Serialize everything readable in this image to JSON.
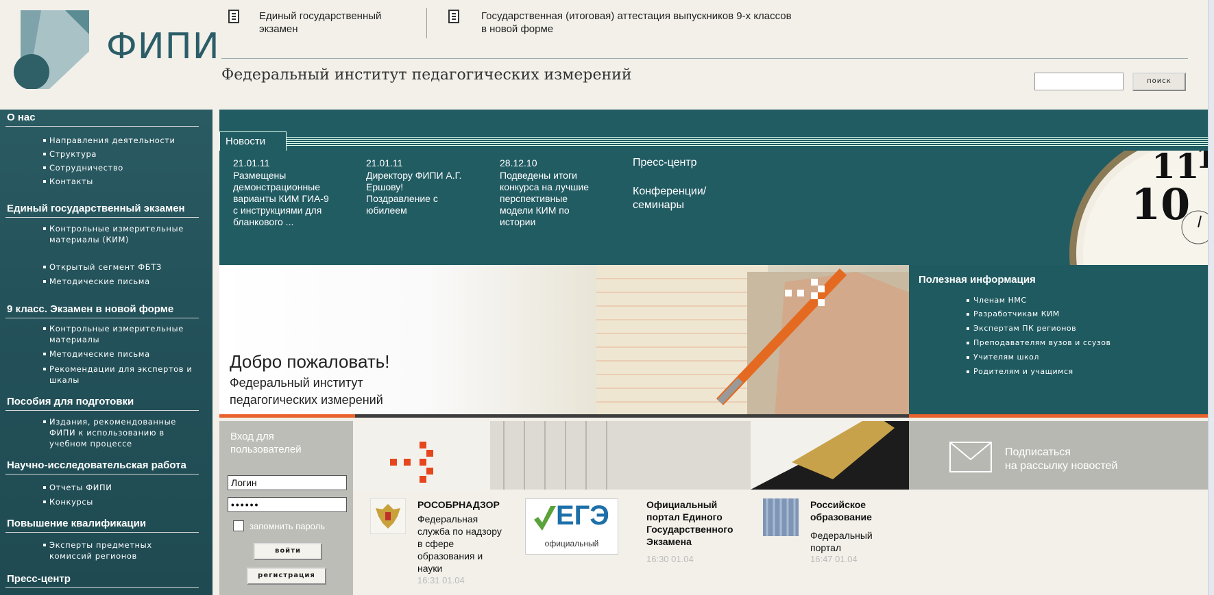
{
  "header": {
    "logo_text": "ФИПИ",
    "link_ege": "Единый государственный экзамен",
    "link_gia": "Государственная (итоговая) аттестация выпускников 9-х классов в новой форме",
    "institute_title": "Федеральный институт педагогических измерений",
    "search_button": "поиск"
  },
  "sidebar": {
    "sections": [
      {
        "title": "О нас",
        "items": [
          "Направления деятельности",
          "Структура",
          "Сотрудничество",
          "Контакты"
        ]
      },
      {
        "title": "Единый государственный экзамен",
        "items": [
          "Контрольные измерительные материалы (КИМ)",
          "Открытый сегмент ФБТЗ",
          "Методические письма"
        ]
      },
      {
        "title": "9 класс. Экзамен в новой форме",
        "items": [
          "Контрольные измерительные материалы",
          "Методические письма",
          "Рекомендации для экспертов и шкалы"
        ]
      },
      {
        "title": "Пособия для подготовки",
        "items": [
          "Издания, рекомендованные ФИПИ к использованию в учебном процессе"
        ]
      },
      {
        "title": "Научно-исследовательская работа",
        "items": [
          "Отчеты ФИПИ",
          "Конкурсы"
        ]
      },
      {
        "title": "Повышение квалификации",
        "items": [
          "Эксперты предметных комиссий регионов"
        ]
      },
      {
        "title": "Пресс-центр",
        "items": []
      }
    ]
  },
  "news": {
    "tab_label": "Новости",
    "items": [
      {
        "date": "21.01.11",
        "text": "Размещены демонстрационные варианты КИМ ГИА-9 с инструкциями для бланкового ..."
      },
      {
        "date": "21.01.11",
        "text": "Директору ФИПИ А.Г. Ершову! Поздравление с юбилеем"
      },
      {
        "date": "28.12.10",
        "text": "Подведены итоги конкурса на лучшие перспективные модели КИМ по истории"
      }
    ],
    "press_center": "Пресс-центр",
    "conferences": "Конференции/ семинары"
  },
  "banner": {
    "welcome": "Добро пожаловать!",
    "subtitle_line1": "Федеральный институт",
    "subtitle_line2": "педагогических измерений"
  },
  "useful": {
    "title": "Полезная информация",
    "items": [
      "Членам НМС",
      "Разработчикам КИМ",
      "Экспертам ПК регионов",
      "Преподавателям вузов и ссузов",
      "Учителям школ",
      "Родителям и учащимся"
    ]
  },
  "login": {
    "title": "Вход для пользователей",
    "login_value": "Логин",
    "password_value": "••••••",
    "remember": "запомнить пароль",
    "login_button": "войти",
    "register_button": "регистрация"
  },
  "subscribe": {
    "line1": "Подписаться",
    "line2": "на рассылку новостей"
  },
  "partners": [
    {
      "title": "РОСОБРНАДЗОР",
      "desc": "Федеральная служба по надзору в сфере образования и науки",
      "time": "16:31 01.04"
    },
    {
      "logo_text": "ЕГЭ",
      "logo_caption": "официальный",
      "title": "Официальный портал Единого Государственного Экзамена",
      "time": "16:30 01.04"
    },
    {
      "title": "Российское образование",
      "desc": "Федеральный портал",
      "time": "16:47 01.04"
    }
  ],
  "colors": {
    "teal": "#225c63",
    "orange": "#e9612b",
    "background": "#f2f0e9"
  }
}
